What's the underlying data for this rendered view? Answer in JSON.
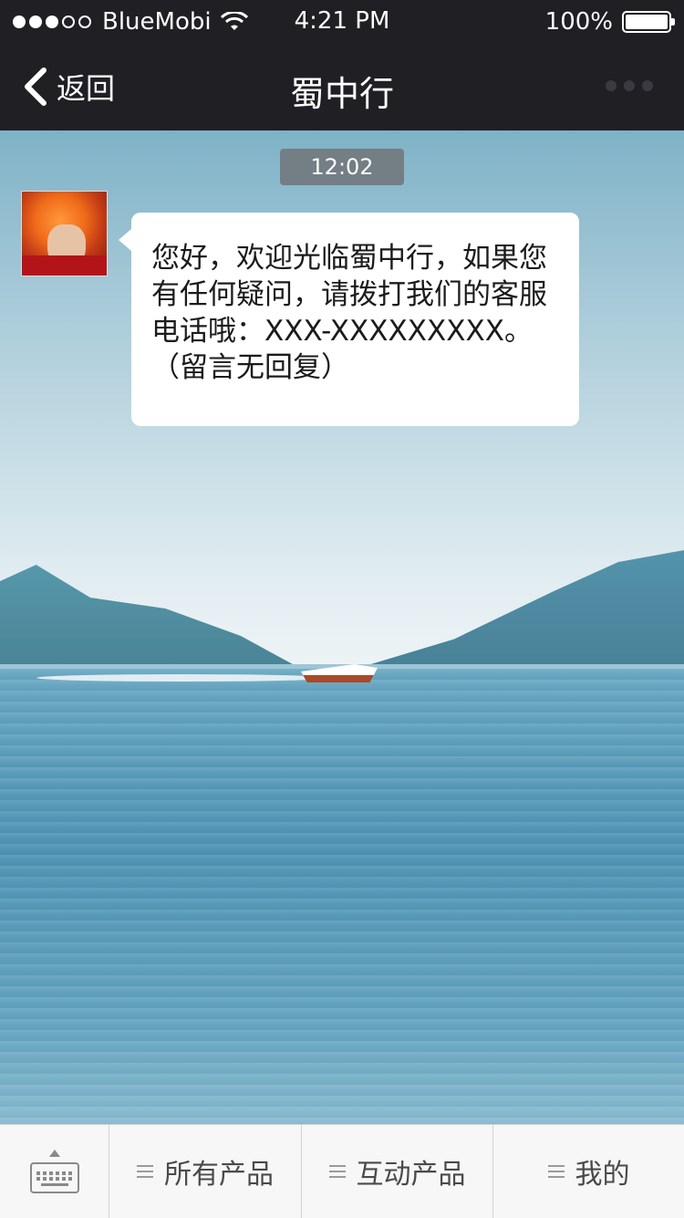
{
  "status_bar": {
    "carrier": "BlueMobi",
    "time": "4:21 PM",
    "battery": "100%",
    "signal_bars_filled": 3,
    "signal_bars_total": 5
  },
  "nav": {
    "back_label": "返回",
    "title": "蜀中行",
    "more_icon": "more-dots-icon"
  },
  "chat": {
    "timestamp": "12:02",
    "messages": [
      {
        "sender": "official-account",
        "text": "您好，欢迎光临蜀中行，如果您有任何疑问，请拨打我们的客服电话哦：XXX-XXXXXXXXX。（留言无回复）"
      }
    ]
  },
  "tabbar": {
    "keyboard_icon": "keyboard-icon",
    "items": [
      {
        "label": "所有产品"
      },
      {
        "label": "互动产品"
      },
      {
        "label": "我的"
      }
    ]
  },
  "colors": {
    "bar_background": "#1f1f24",
    "timestamp_bg": "#747e85",
    "bubble_bg": "#ffffff",
    "tabbar_bg": "#f7f7f7"
  }
}
